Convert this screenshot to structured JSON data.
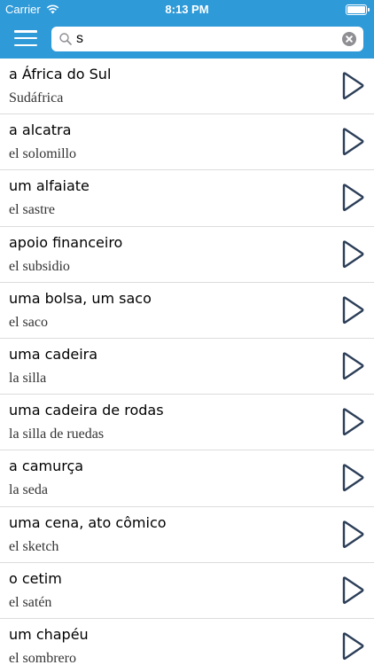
{
  "status_bar": {
    "carrier": "Carrier",
    "time": "8:13 PM"
  },
  "search": {
    "value": "s"
  },
  "items": [
    {
      "pt": "a África do Sul",
      "es": "Sudáfrica"
    },
    {
      "pt": "a alcatra",
      "es": "el solomillo"
    },
    {
      "pt": "um alfaiate",
      "es": "el sastre"
    },
    {
      "pt": "apoio financeiro",
      "es": "el subsidio"
    },
    {
      "pt": "uma bolsa, um saco",
      "es": "el saco"
    },
    {
      "pt": "uma cadeira",
      "es": "la silla"
    },
    {
      "pt": "uma cadeira de rodas",
      "es": "la silla de ruedas"
    },
    {
      "pt": "a camurça",
      "es": "la seda"
    },
    {
      "pt": "uma cena, ato cômico",
      "es": "el sketch"
    },
    {
      "pt": "o cetim",
      "es": "el satén"
    },
    {
      "pt": "um chapéu",
      "es": "el sombrero"
    }
  ],
  "colors": {
    "header": "#2f9ad8",
    "play_icon": "#2c3e58"
  }
}
